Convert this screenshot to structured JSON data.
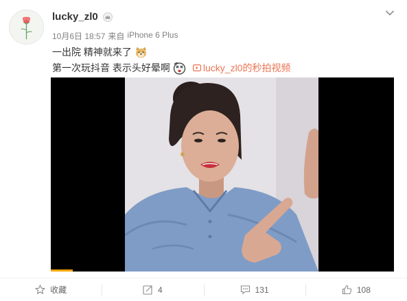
{
  "post": {
    "author": {
      "username": "lucky_zl0",
      "avatar": "carnation-flower-avatar",
      "badge_icon": "crown-member-icon"
    },
    "meta": {
      "date": "10月6日 18:57",
      "source_prefix": "来自",
      "source": "iPhone 6 Plus"
    },
    "menu_icon": "chevron-down-icon",
    "text": {
      "line1": "一出院 精神就来了",
      "line1_emoji": "doge-emoji",
      "line2": "第一次玩抖音 表示头好晕啊",
      "line2_emoji": "dizzy-face-emoji",
      "video_link_icon": "video-play-icon",
      "video_link": "lucky_zl0的秒拍视频"
    },
    "video": {
      "thumbnail": "woman-in-blue-shirt-pointing",
      "progress": 0.064
    }
  },
  "actions": {
    "favorite": {
      "icon": "star-icon",
      "label": "收藏"
    },
    "repost": {
      "icon": "share-icon",
      "count": "4"
    },
    "comment": {
      "icon": "comment-icon",
      "count": "131"
    },
    "like": {
      "icon": "thumbs-up-icon",
      "count": "108"
    }
  },
  "colors": {
    "link": "#eb7350",
    "meta_text": "#808080",
    "progress": "#f7a600"
  }
}
